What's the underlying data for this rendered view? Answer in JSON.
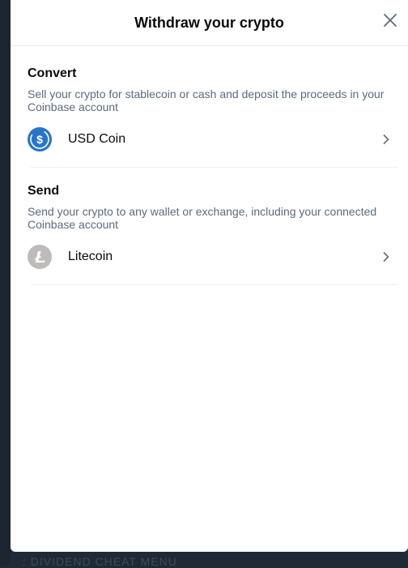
{
  "modal": {
    "title": "Withdraw your crypto",
    "close_icon": "close-icon"
  },
  "sections": [
    {
      "title": "Convert",
      "description": "Sell your crypto for stablecoin or cash and deposit the proceeds in your Coinbase account",
      "items": [
        {
          "label": "USD Coin",
          "icon": "usdc-icon",
          "icon_color": "#2775ca"
        }
      ]
    },
    {
      "title": "Send",
      "description": "Send your crypto to any wallet or exchange, including your connected Coinbase account",
      "items": [
        {
          "label": "Litecoin",
          "icon": "litecoin-icon",
          "icon_color": "#bfbbbb"
        }
      ]
    }
  ],
  "colors": {
    "backdrop": "#1f2a36",
    "text_primary": "#0a0b0d",
    "text_secondary": "#5b6b7d",
    "chevron": "#5b6b7d"
  }
}
